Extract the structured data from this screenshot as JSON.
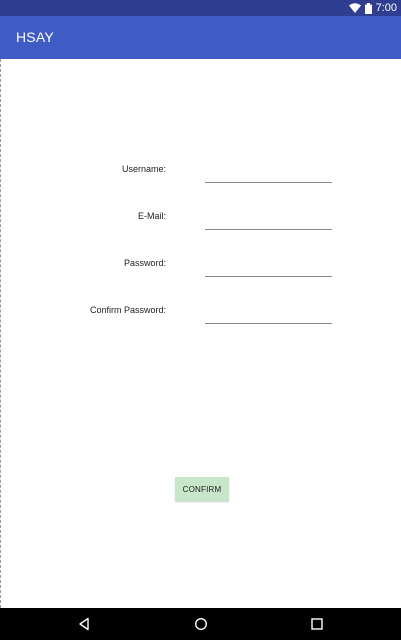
{
  "status_bar": {
    "time": "7:00",
    "icons": [
      "wifi-icon",
      "battery-icon"
    ],
    "background": "#2f3e91"
  },
  "app_bar": {
    "title": "HSAY",
    "background": "#3f5cc4"
  },
  "form": {
    "fields": [
      {
        "label": "Username:",
        "value": ""
      },
      {
        "label": "E-Mail:",
        "value": ""
      },
      {
        "label": "Password:",
        "value": ""
      },
      {
        "label": "Confirm Password:",
        "value": ""
      }
    ],
    "confirm_label": "CONFIRM",
    "confirm_color": "#c8e6c9"
  },
  "nav_bar": {
    "icons": [
      "back-icon",
      "home-icon",
      "recents-icon"
    ]
  }
}
